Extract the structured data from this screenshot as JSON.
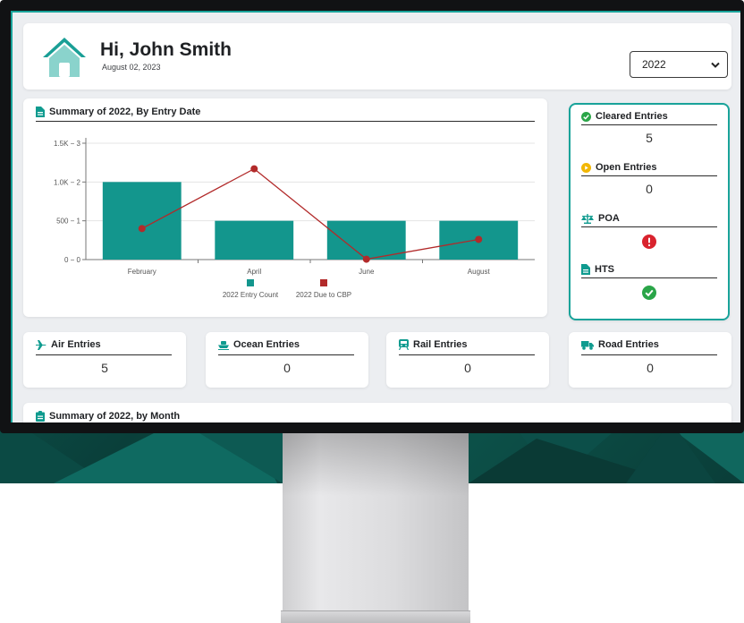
{
  "header": {
    "greeting": "Hi, John Smith",
    "date": "August 02, 2023",
    "year_selected": "2022"
  },
  "chart_card": {
    "title": "Summary of 2022, By Entry Date"
  },
  "chart_data": {
    "type": "bar",
    "title": "Summary of 2022, By Entry Date",
    "categories": [
      "February",
      "April",
      "June",
      "August"
    ],
    "series": [
      {
        "name": "2022 Entry Count",
        "type": "bar",
        "axis": "right",
        "values": [
          2,
          1,
          1,
          1
        ],
        "color": "#13968d"
      },
      {
        "name": "2022 Due to CBP",
        "type": "line",
        "axis": "left",
        "values": [
          400,
          1170,
          5,
          260
        ],
        "color": "#b22a2a"
      }
    ],
    "y_left": {
      "ticks": [
        "0",
        "500",
        "1.0K",
        "1.5K"
      ],
      "range": [
        0,
        1500
      ]
    },
    "y_right": {
      "ticks": [
        "0",
        "1",
        "2",
        "3"
      ],
      "range": [
        0,
        3
      ]
    },
    "tick_labels_combined": [
      "0 − 0",
      "500 − 1",
      "1.0K − 2",
      "1.5K − 3"
    ],
    "legend": "bottom-center"
  },
  "status": {
    "cleared": {
      "title": "Cleared Entries",
      "value": "5",
      "icon": "check-circle-icon",
      "color": "#2aa548"
    },
    "open": {
      "title": "Open Entries",
      "value": "0",
      "icon": "play-circle-icon",
      "color": "#f2b705"
    },
    "poa": {
      "title": "POA",
      "icon": "scales-icon",
      "state_icon": "exclamation-circle-icon",
      "state_color": "#d9232e"
    },
    "hts": {
      "title": "HTS",
      "icon": "document-icon",
      "state_icon": "check-circle-icon",
      "state_color": "#2aa548"
    }
  },
  "modes": [
    {
      "title": "Air Entries",
      "value": "5",
      "icon": "plane-icon"
    },
    {
      "title": "Ocean Entries",
      "value": "0",
      "icon": "ship-icon"
    },
    {
      "title": "Rail Entries",
      "value": "0",
      "icon": "train-icon"
    },
    {
      "title": "Road Entries",
      "value": "0",
      "icon": "truck-icon"
    }
  ],
  "month_card": {
    "title": "Summary of 2022, by Month"
  },
  "colors": {
    "accent": "#19a39a",
    "bar": "#13968d",
    "line": "#b22a2a",
    "icon_teal": "#0f9b8f"
  }
}
